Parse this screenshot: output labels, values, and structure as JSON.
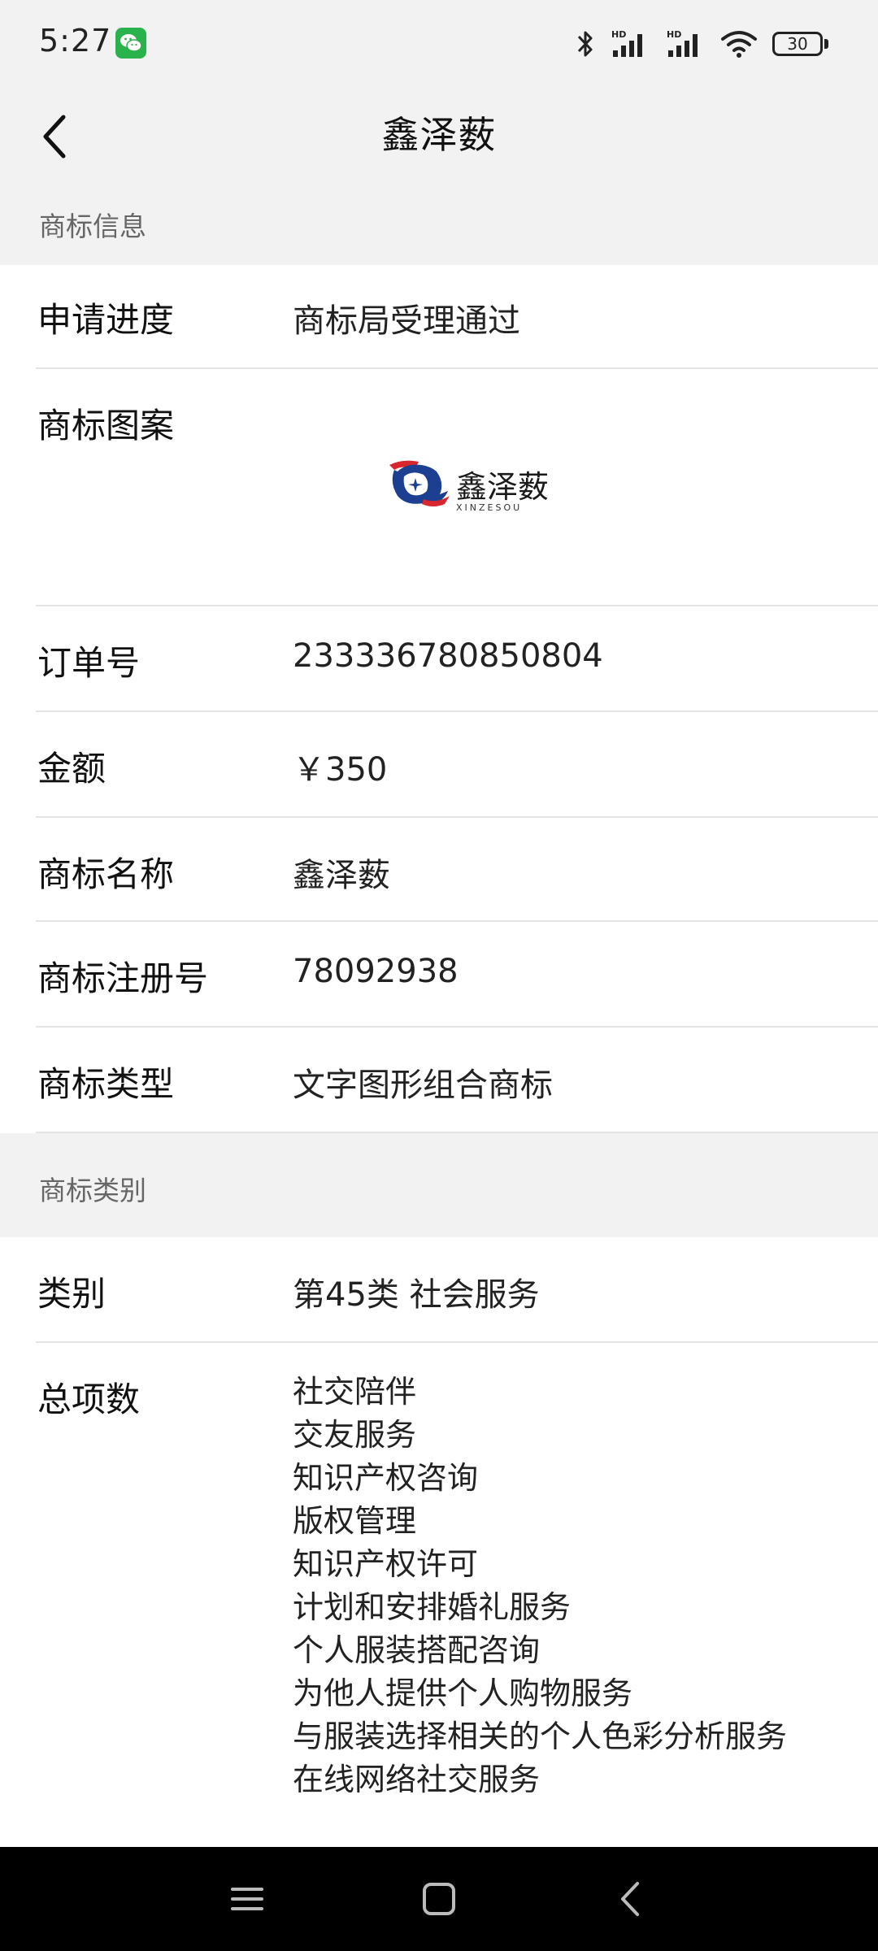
{
  "status_bar": {
    "time": "5:27",
    "battery": "30",
    "icons": [
      "wechat-icon",
      "bluetooth-icon",
      "signal-hd-icon",
      "signal-hd-icon",
      "wifi-icon",
      "battery-icon"
    ]
  },
  "header": {
    "title": "鑫泽薮",
    "back_icon": "chevron-left-icon"
  },
  "section_info": {
    "title": "商标信息",
    "rows": {
      "progress": {
        "label": "申请进度",
        "value": "商标局受理通过"
      },
      "pattern": {
        "label": "商标图案"
      },
      "order": {
        "label": "订单号",
        "value": "233336780850804"
      },
      "amount": {
        "label": "金额",
        "value": "￥350"
      },
      "name": {
        "label": "商标名称",
        "value": "鑫泽薮"
      },
      "reg_no": {
        "label": "商标注册号",
        "value": "78092938"
      },
      "type": {
        "label": "商标类型",
        "value": "文字图形组合商标"
      }
    }
  },
  "logo": {
    "text": "鑫泽薮",
    "sub": "XINZESOU"
  },
  "section_category": {
    "title": "商标类别",
    "class_row": {
      "label": "类别",
      "value": "第45类 社会服务"
    },
    "items_row": {
      "label": "总项数",
      "items": [
        "社交陪伴",
        "交友服务",
        "知识产权咨询",
        "版权管理",
        "知识产权许可",
        "计划和安排婚礼服务",
        "个人服装搭配咨询",
        "为他人提供个人购物服务",
        "与服装选择相关的个人色彩分析服务",
        "在线网络社交服务"
      ]
    }
  },
  "nav_bar": {
    "icons": [
      "menu-icon",
      "home-icon",
      "back-icon"
    ]
  }
}
